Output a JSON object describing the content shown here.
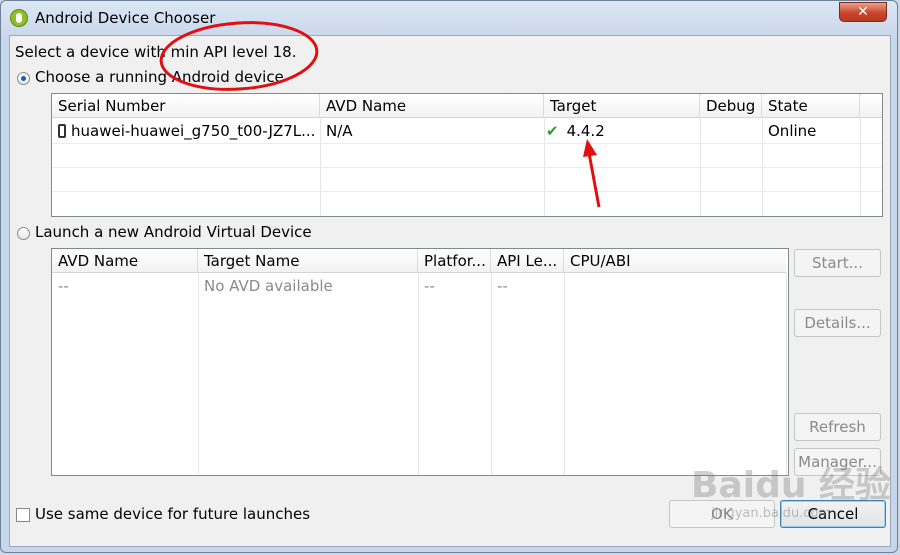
{
  "window": {
    "title": "Android Device Chooser",
    "close_label": "✕"
  },
  "header_text": "Select a device with min API level 18.",
  "running": {
    "radio_label": "Choose a running Android device",
    "columns": [
      "Serial Number",
      "AVD Name",
      "Target",
      "Debug",
      "State"
    ],
    "rows": [
      {
        "serial": "huawei-huawei_g750_t00-JZ7L...",
        "avd": "N/A",
        "target": "4.4.2",
        "debug": "",
        "state": "Online"
      }
    ]
  },
  "launch": {
    "radio_label": "Launch a new Android Virtual Device",
    "columns": [
      "AVD Name",
      "Target Name",
      "Platfor...",
      "API Le...",
      "CPU/ABI"
    ],
    "rows": [
      {
        "avd": "--",
        "target": "No AVD available",
        "platform": "--",
        "api": "--",
        "cpu": ""
      }
    ],
    "buttons": {
      "start": "Start...",
      "details": "Details...",
      "refresh": "Refresh",
      "manager": "Manager..."
    }
  },
  "footer": {
    "checkbox_label": "Use same device for future launches",
    "ok_label": "OK",
    "cancel_label": "Cancel"
  },
  "watermark": {
    "main": "Baidu 经验",
    "sub": "jingyan.baidu.com"
  },
  "colors": {
    "annotation_red": "#e01010",
    "check_green": "#2e9e2e"
  }
}
